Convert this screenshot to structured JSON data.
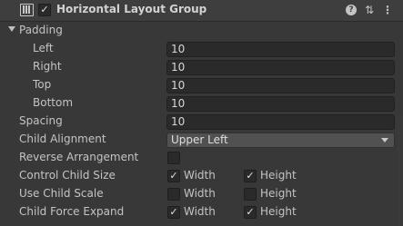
{
  "component": {
    "title": "Horizontal Layout Group",
    "enabled": true,
    "header_buttons": [
      "help-icon",
      "presets-icon",
      "kebab-menu-icon"
    ]
  },
  "padding": {
    "label": "Padding",
    "expanded": true,
    "left": {
      "label": "Left",
      "value": "10"
    },
    "right": {
      "label": "Right",
      "value": "10"
    },
    "top": {
      "label": "Top",
      "value": "10"
    },
    "bottom": {
      "label": "Bottom",
      "value": "10"
    }
  },
  "spacing": {
    "label": "Spacing",
    "value": "10"
  },
  "child_alignment": {
    "label": "Child Alignment",
    "value": "Upper Left"
  },
  "reverse_arrangement": {
    "label": "Reverse Arrangement",
    "checked": false
  },
  "control_child_size": {
    "label": "Control Child Size",
    "width": {
      "label": "Width",
      "checked": true
    },
    "height": {
      "label": "Height",
      "checked": true
    }
  },
  "use_child_scale": {
    "label": "Use Child Scale",
    "width": {
      "label": "Width",
      "checked": false
    },
    "height": {
      "label": "Height",
      "checked": false
    }
  },
  "child_force_expand": {
    "label": "Child Force Expand",
    "width": {
      "label": "Width",
      "checked": true
    },
    "height": {
      "label": "Height",
      "checked": true
    }
  },
  "glyphs": {
    "check": "✓",
    "question": "?",
    "presets": "⇅",
    "kebab": "⋮"
  }
}
